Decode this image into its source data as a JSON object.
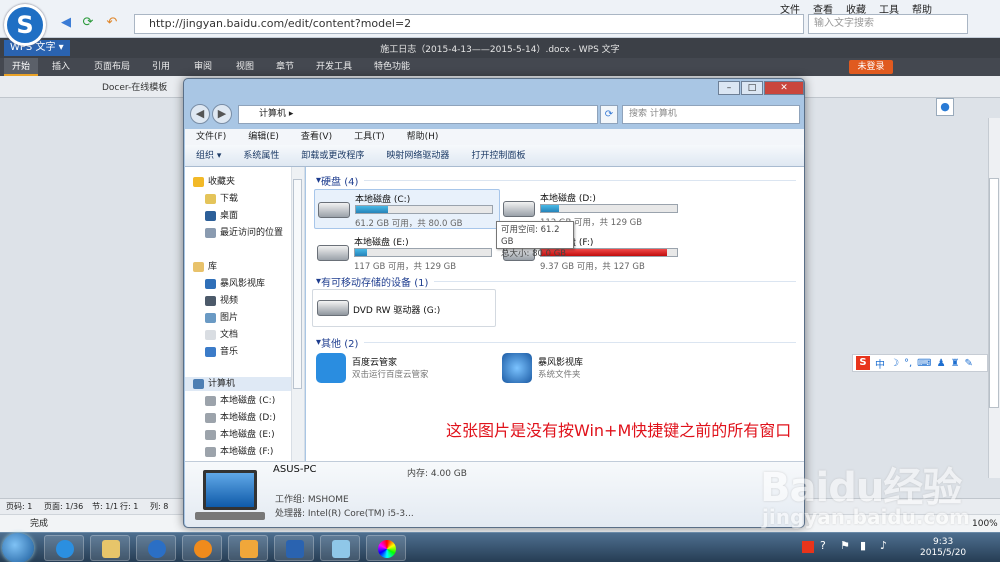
{
  "browser": {
    "url": "http://jingyan.baidu.com/edit/content?model=2",
    "search_placeholder": "输入文字搜索",
    "menu": [
      "文件",
      "查看",
      "收藏",
      "工具",
      "帮助"
    ]
  },
  "wps": {
    "app_button": "WPS 文字",
    "doc_title": "施工日志（2015-4-13——2015-5-14）.docx - WPS 文字",
    "ribbon_tabs": [
      "开始",
      "插入",
      "页面布局",
      "引用",
      "审阅",
      "视图",
      "章节",
      "开发工具",
      "特色功能"
    ],
    "login": "未登录",
    "docer_tab": "Docer-在线模板",
    "status": [
      "页码: 1",
      "页面: 1/36",
      "节: 1/1",
      "行: 1",
      "列: 8"
    ],
    "done": "完成",
    "zoom": "100%"
  },
  "explorer": {
    "address": "计算机",
    "search_placeholder": "搜索 计算机",
    "menu": [
      "文件(F)",
      "编辑(E)",
      "查看(V)",
      "工具(T)",
      "帮助(H)"
    ],
    "commands": [
      "组织 ▾",
      "系统属性",
      "卸载或更改程序",
      "映射网络驱动器",
      "打开控制面板"
    ],
    "nav": {
      "favorites": "收藏夹",
      "fav_items": [
        "下载",
        "桌面",
        "最近访问的位置"
      ],
      "library": "库",
      "lib_items": [
        "暴风影视库",
        "视频",
        "图片",
        "文档",
        "音乐"
      ],
      "computer": "计算机",
      "comp_items": [
        "本地磁盘 (C:)",
        "本地磁盘 (D:)",
        "本地磁盘 (E:)",
        "本地磁盘 (F:)"
      ]
    },
    "group_hdd": "硬盘 (4)",
    "drives": [
      {
        "name": "本地磁盘 (C:)",
        "info": "61.2 GB 可用，共 80.0 GB",
        "used": 0.235,
        "red": false
      },
      {
        "name": "本地磁盘 (D:)",
        "info": "112 GB 可用，共 129 GB",
        "used": 0.13,
        "red": false
      },
      {
        "name": "本地磁盘 (E:)",
        "info": "117 GB 可用，共 129 GB",
        "used": 0.09,
        "red": false
      },
      {
        "name": "本地磁盘 (F:)",
        "info": "9.37 GB 可用，共 127 GB",
        "used": 0.93,
        "red": true
      }
    ],
    "tooltip": [
      "可用空间: 61.2 GB",
      "总大小: 80.0 GB"
    ],
    "group_removable": "有可移动存储的设备 (1)",
    "dvd": "DVD RW 驱动器 (G:)",
    "group_other": "其他 (2)",
    "apps": [
      {
        "name": "百度云管家",
        "sub": "双击运行百度云管家"
      },
      {
        "name": "暴风影视库",
        "sub": "系统文件夹"
      }
    ],
    "note": "这张图片是没有按Win+M快捷键之前的所有窗口",
    "details": {
      "pc_name": "ASUS-PC",
      "memory": "内存: 4.00 GB",
      "workgroup": "工作组: MSHOME",
      "cpu": "处理器: Intel(R) Core(TM) i5-3..."
    }
  },
  "ime": {
    "mode": "中"
  },
  "watermark": {
    "text": "Baidu经验",
    "url": "jingyan.baidu.com"
  },
  "taskbar": {
    "time": "9:33",
    "date": "2015/5/20"
  }
}
